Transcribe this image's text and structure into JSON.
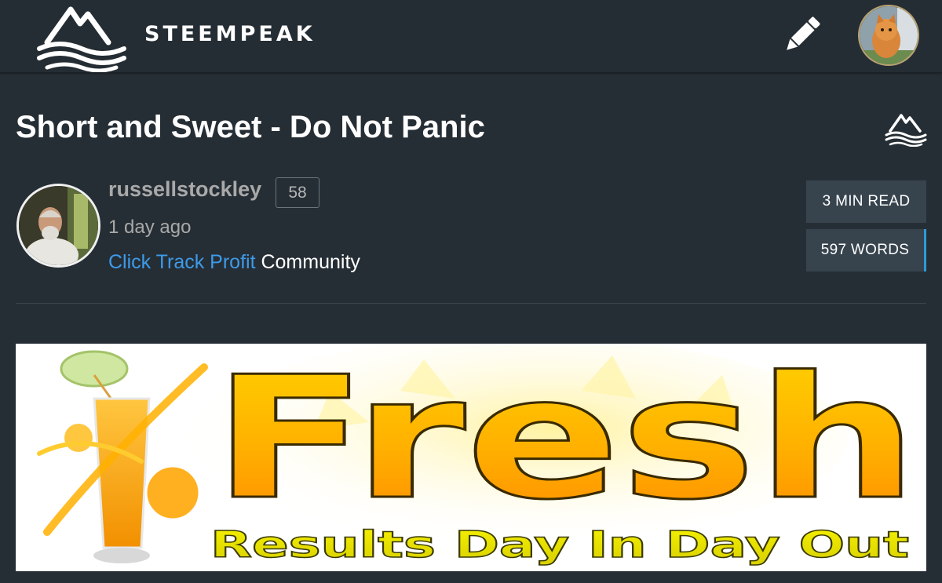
{
  "header": {
    "brand": "STEEMPEAK",
    "logo_icon": "mountain-waves-logo",
    "compose_icon": "pencil-icon",
    "user_avatar": "kitten-avatar"
  },
  "post": {
    "title": "Short and Sweet - Do Not Panic",
    "author": {
      "name": "russellstockley",
      "reputation": "58",
      "avatar": "author-avatar"
    },
    "time_ago": "1 day ago",
    "community": {
      "name": "Click Track Profit",
      "suffix": " Community"
    },
    "stats": {
      "read_time": "3 MIN READ",
      "word_count": "597 WORDS"
    },
    "banner": {
      "headline": "Fresh",
      "tagline": "Results Day In Day Out"
    }
  },
  "colors": {
    "background": "#262e35",
    "link": "#3d9bea",
    "stat_bg": "#37444e",
    "stat_accent": "#2e9bd6"
  }
}
